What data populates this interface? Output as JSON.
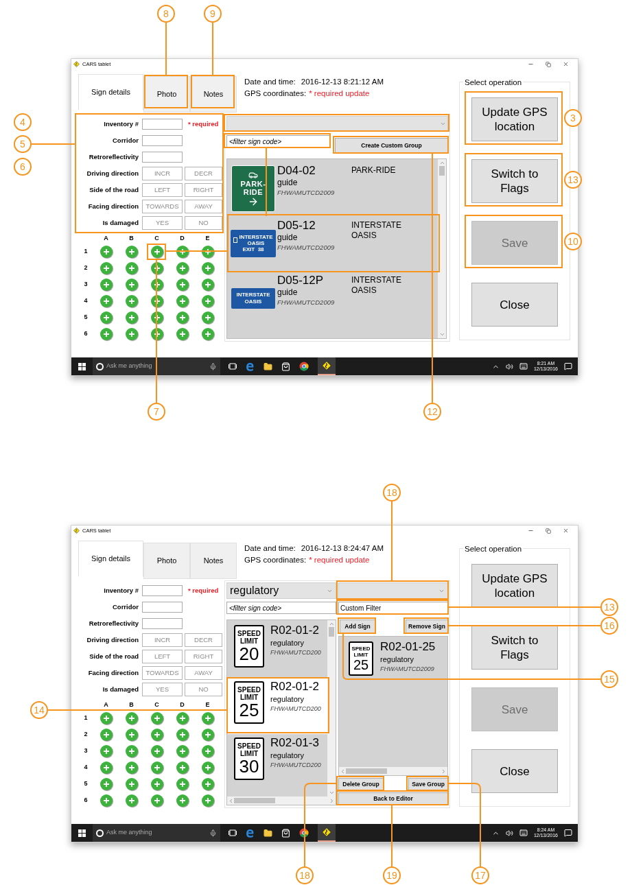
{
  "figures": [
    {
      "kind": "editor",
      "window": {
        "title": "CARS tablet"
      },
      "tabs": [
        {
          "label": "Sign details",
          "selected": true
        },
        {
          "label": "Photo",
          "selected": false
        },
        {
          "label": "Notes",
          "selected": false
        }
      ],
      "info": {
        "date_label": "Date and time:",
        "date_value": "2016-12-13 8:21:12 AM",
        "gps_label": "GPS coordinates:",
        "gps_value": "* required update"
      },
      "form": [
        {
          "kind": "text",
          "label": "Inventory #",
          "note": "* required"
        },
        {
          "kind": "text",
          "label": "Corridor"
        },
        {
          "kind": "text",
          "label": "Retroreflectivity"
        },
        {
          "kind": "choice",
          "label": "Driving direction",
          "options": [
            "INCR",
            "DECR"
          ]
        },
        {
          "kind": "choice",
          "label": "Side of the road",
          "options": [
            "LEFT",
            "RIGHT"
          ]
        },
        {
          "kind": "choice",
          "label": "Facing direction",
          "options": [
            "TOWARDS",
            "AWAY"
          ]
        },
        {
          "kind": "choice",
          "label": "Is damaged",
          "options": [
            "YES",
            "NO"
          ]
        }
      ],
      "grid": {
        "columns": [
          "A",
          "B",
          "C",
          "D",
          "E"
        ],
        "rows": [
          "1",
          "2",
          "3",
          "4",
          "5",
          "6"
        ]
      },
      "sign_panel": {
        "filter_placeholder": "<filter sign code>",
        "create_button": "Create Custom Group",
        "signs": [
          {
            "code": "D04-02",
            "category": "guide",
            "source": "FHWAMUTCD2009",
            "description": "PARK-RIDE",
            "selected": false,
            "sign": {
              "kind": "park_ride",
              "lines": [
                "PARK-",
                "RIDE"
              ]
            }
          },
          {
            "code": "D05-12",
            "category": "guide",
            "source": "FHWAMUTCD2009",
            "description": "INTERSTATE OASIS",
            "selected": false,
            "sign": {
              "kind": "interstate_exit",
              "lines": [
                "INTERSTATE",
                "OASIS",
                "EXIT  38"
              ]
            }
          },
          {
            "code": "D05-12P",
            "category": "guide",
            "source": "FHWAMUTCD2009",
            "description": "INTERSTATE OASIS",
            "selected": false,
            "sign": {
              "kind": "interstate",
              "lines": [
                "INTERSTATE",
                "OASIS"
              ]
            }
          }
        ]
      },
      "operations": {
        "title": "Select operation",
        "buttons": [
          {
            "label": "Update GPS location",
            "disabled": false
          },
          {
            "label": "Switch to Flags",
            "disabled": false
          },
          {
            "label": "Save",
            "disabled": true
          },
          {
            "label": "Close",
            "disabled": false
          }
        ]
      },
      "taskbar": {
        "search_placeholder": "Ask me anything",
        "time": "8:21 AM",
        "date": "12/13/2016"
      },
      "callouts": [
        {
          "number": "8"
        },
        {
          "number": "9"
        },
        {
          "number": "4"
        },
        {
          "number": "5"
        },
        {
          "number": "6"
        },
        {
          "number": "3"
        },
        {
          "number": "13"
        },
        {
          "number": "10"
        },
        {
          "number": "7"
        },
        {
          "number": "12"
        }
      ]
    },
    {
      "kind": "custom_group",
      "window": {
        "title": "CARS tablet"
      },
      "tabs": [
        {
          "label": "Sign details",
          "selected": true
        },
        {
          "label": "Photo",
          "selected": false
        },
        {
          "label": "Notes",
          "selected": false
        }
      ],
      "info": {
        "date_label": "Date and time:",
        "date_value": "2016-12-13 8:24:47 AM",
        "gps_label": "GPS coordinates:",
        "gps_value": "* required update"
      },
      "form": [
        {
          "kind": "text",
          "label": "Inventory #",
          "note": "* required"
        },
        {
          "kind": "text",
          "label": "Corridor"
        },
        {
          "kind": "text",
          "label": "Retroreflectivity"
        },
        {
          "kind": "choice",
          "label": "Driving direction",
          "options": [
            "INCR",
            "DECR"
          ]
        },
        {
          "kind": "choice",
          "label": "Side of the road",
          "options": [
            "LEFT",
            "RIGHT"
          ]
        },
        {
          "kind": "choice",
          "label": "Facing direction",
          "options": [
            "TOWARDS",
            "AWAY"
          ]
        },
        {
          "kind": "choice",
          "label": "Is damaged",
          "options": [
            "YES",
            "NO"
          ]
        }
      ],
      "grid": {
        "columns": [
          "A",
          "B",
          "C",
          "D",
          "E"
        ],
        "rows": [
          "1",
          "2",
          "3",
          "4",
          "5",
          "6"
        ]
      },
      "sign_panel": {
        "category": "regulatory",
        "filter_placeholder": "<filter sign code>",
        "signs": [
          {
            "code": "R02-01-2",
            "category": "regulatory",
            "source": "FHWAMUTCD200",
            "selected": false,
            "sign": {
              "kind": "speed_limit",
              "lines": [
                "SPEED",
                "LIMIT",
                "20"
              ]
            }
          },
          {
            "code": "R02-01-2",
            "category": "regulatory",
            "source": "FHWAMUTCD200",
            "selected": true,
            "sign": {
              "kind": "speed_limit",
              "lines": [
                "SPEED",
                "LIMIT",
                "25"
              ]
            }
          },
          {
            "code": "R02-01-3",
            "category": "regulatory",
            "source": "FHWAMUTCD200",
            "selected": false,
            "sign": {
              "kind": "speed_limit",
              "lines": [
                "SPEED",
                "LIMIT",
                "30"
              ]
            }
          }
        ]
      },
      "custom_group": {
        "filter_value": "Custom Filter",
        "add_button": "Add Sign",
        "remove_button": "Remove Sign",
        "delete_button": "Delete Group",
        "save_button": "Save Group",
        "back_button": "Back to Editor",
        "signs": [
          {
            "code": "R02-01-25",
            "category": "regulatory",
            "source": "FHWAMUTCD2009",
            "selected": false,
            "sign": {
              "kind": "speed_limit",
              "lines": [
                "SPEED",
                "LIMIT",
                "25"
              ]
            }
          }
        ]
      },
      "operations": {
        "title": "Select operation",
        "buttons": [
          {
            "label": "Update GPS location",
            "disabled": false
          },
          {
            "label": "Switch to Flags",
            "disabled": false
          },
          {
            "label": "Save",
            "disabled": true
          },
          {
            "label": "Close",
            "disabled": false
          }
        ]
      },
      "taskbar": {
        "search_placeholder": "Ask me anything",
        "time": "8:24 AM",
        "date": "12/13/2016"
      },
      "callouts": [
        {
          "number": "18"
        },
        {
          "number": "13"
        },
        {
          "number": "16"
        },
        {
          "number": "15"
        },
        {
          "number": "14"
        },
        {
          "number": "18"
        },
        {
          "number": "19"
        },
        {
          "number": "17"
        }
      ]
    }
  ]
}
